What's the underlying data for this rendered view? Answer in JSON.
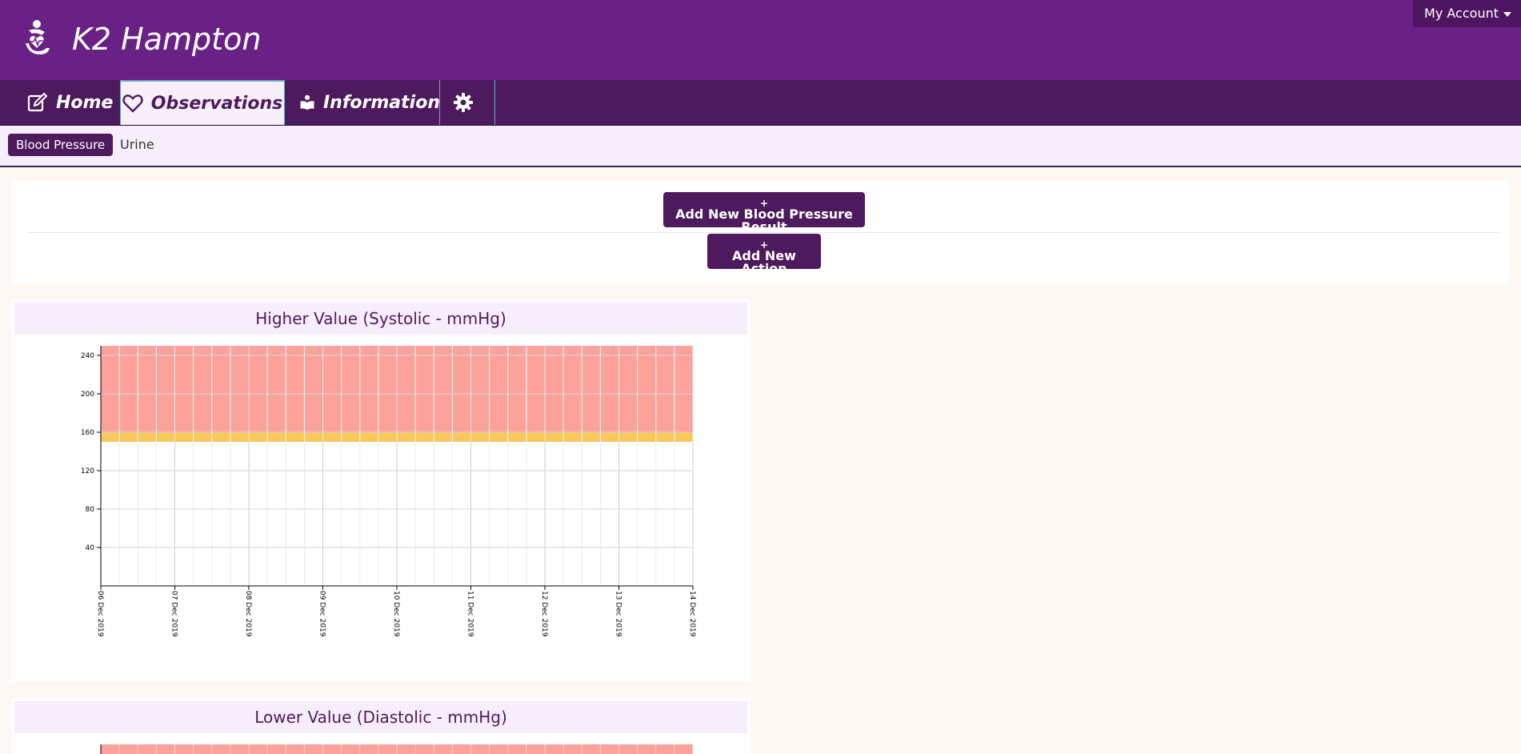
{
  "header": {
    "brand": "K2 Hampton",
    "account_label": "My Account",
    "colors": {
      "header": "#692185",
      "nav": "#4e1a5e"
    }
  },
  "nav": {
    "tabs": [
      {
        "label": "Home",
        "icon": "edit-icon"
      },
      {
        "label": "Observations",
        "icon": "heart-icon",
        "active": true
      },
      {
        "label": "Information",
        "icon": "reader-icon"
      },
      {
        "label": "",
        "icon": "gear-icon"
      }
    ]
  },
  "subnav": {
    "items": [
      {
        "label": "Blood Pressure",
        "active": true
      },
      {
        "label": "Urine"
      }
    ]
  },
  "actions": {
    "add_bp_plus": "+",
    "add_bp_label": "Add New Blood Pressure Result",
    "add_action_plus": "+",
    "add_action_label": "Add New Action"
  },
  "chart_data": [
    {
      "type": "line",
      "title": "Higher Value (Systolic - mmHg)",
      "x": [
        "06 Dec 2019",
        "07 Dec 2019",
        "08 Dec 2019",
        "09 Dec 2019",
        "10 Dec 2019",
        "11 Dec 2019",
        "12 Dec 2019",
        "13 Dec 2019",
        "14 Dec 2019"
      ],
      "series": [],
      "ylim": [
        0,
        250
      ],
      "yticks": [
        40,
        80,
        120,
        160,
        200,
        240
      ],
      "bands": [
        {
          "from": 150,
          "to": 160,
          "color": "#f9c75c"
        },
        {
          "from": 160,
          "to": 250,
          "color": "#fca29a"
        }
      ],
      "grid": true
    },
    {
      "type": "line",
      "title": "Lower Value (Diastolic - mmHg)",
      "x": [],
      "series": [],
      "grid": true
    }
  ]
}
